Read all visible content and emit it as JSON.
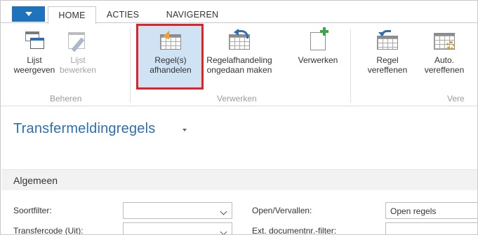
{
  "ribbon": {
    "tabs": [
      {
        "label": "HOME",
        "active": true
      },
      {
        "label": "ACTIES",
        "active": false
      },
      {
        "label": "NAVIGEREN",
        "active": false
      }
    ],
    "groups": {
      "beheren": "Beheren",
      "verwerken": "Verwerken",
      "vereffenen_partial": "Vere"
    },
    "buttons": {
      "lijst_weergeven": {
        "line1": "Lijst",
        "line2": "weergeven",
        "enabled": true
      },
      "lijst_bewerken": {
        "line1": "Lijst",
        "line2": "bewerken",
        "enabled": false
      },
      "regels_afhandelen": {
        "line1": "Regel(s)",
        "line2": "afhandelen",
        "enabled": true,
        "highlighted": true
      },
      "regelafhandeling_ongedaan": {
        "line1": "Regelafhandeling",
        "line2": "ongedaan maken",
        "enabled": true
      },
      "verwerken": {
        "line1": "Verwerken",
        "line2": "",
        "enabled": true
      },
      "regel_vereffenen": {
        "line1": "Regel",
        "line2": "vereffenen",
        "enabled": true
      },
      "auto_vereffenen": {
        "line1": "Auto.",
        "line2": "vereffenen",
        "enabled": true
      }
    },
    "accent_color": "#1e73be",
    "highlight_color": "#d9262c"
  },
  "page": {
    "title": "Transfermeldingregels"
  },
  "fasttab": {
    "title": "Algemeen"
  },
  "fields": {
    "soortfilter": {
      "label": "Soortfilter:",
      "value": ""
    },
    "transfercode": {
      "label": "Transfercode (Uit):",
      "value": ""
    },
    "open_vervallen": {
      "label": "Open/Vervallen:",
      "value": "Open regels"
    },
    "ext_documentnr": {
      "label": "Ext. documentnr.-filter:",
      "value": ""
    }
  }
}
